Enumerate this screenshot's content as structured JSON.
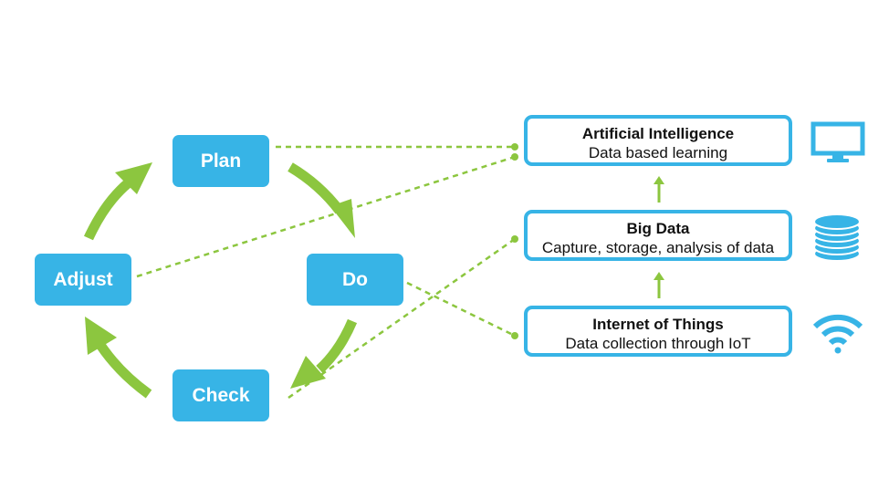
{
  "colors": {
    "box_fill": "#37b4e6",
    "arrow_green": "#8cc63f",
    "dotted_green": "#8cc63f",
    "layer_border": "#37b4e6",
    "icon_blue": "#37b4e6"
  },
  "cycle": {
    "plan": "Plan",
    "do": "Do",
    "check": "Check",
    "adjust": "Adjust"
  },
  "layers": [
    {
      "title": "Artificial Intelligence",
      "subtitle": "Data based learning",
      "icon": "monitor-icon"
    },
    {
      "title": "Big Data",
      "subtitle": "Capture, storage, analysis of data",
      "icon": "database-icon"
    },
    {
      "title": "Internet of Things",
      "subtitle": "Data collection through IoT",
      "icon": "wifi-icon"
    }
  ]
}
